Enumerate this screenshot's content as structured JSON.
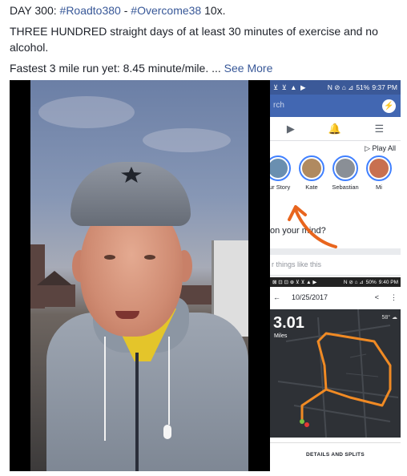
{
  "post": {
    "line1_prefix": "DAY 300: ",
    "hashtag1": "#Roadto380",
    "separator": " - ",
    "hashtag2": "#Overcome38",
    "line1_suffix": " 10x.",
    "line2": "THREE HUNDRED straight days of at least 30 minutes of exercise and no alcohol.",
    "line3": "Fastest 3 mile run yet: 8.45 minute/mile. ...",
    "see_more": "See More"
  },
  "phone1": {
    "status_icons": "⊻ ⊻ ▲ ▶",
    "status_right_icons": "N ⊘ ⌂ ⊿",
    "battery": "51%",
    "time": "9:37 PM",
    "search_placeholder": "rch",
    "play_all": "Play All",
    "stories": [
      {
        "label": "our Story",
        "color": "#6a8fb0"
      },
      {
        "label": "Kate",
        "color": "#b08a60"
      },
      {
        "label": "Sebastian",
        "color": "#8a8f96"
      },
      {
        "label": "Mi",
        "color": "#c87050"
      }
    ],
    "mind_prompt": "on your mind?",
    "things_placeholder": "r things like this",
    "arrow_color": "#e8651e"
  },
  "phone2": {
    "status_icons": "⊠ ⊡ ⊡ ⊕ ⊻ ⊻ ▲ ▶",
    "status_right_icons": "N ⊘ ⌂ ⊿",
    "battery": "50%",
    "time": "9:40 PM",
    "back": "←",
    "date": "10/25/2017",
    "distance": "3.01",
    "distance_unit": "Miles",
    "weather": "58°",
    "details_button": "DETAILS AND SPLITS",
    "route_color": "#f08a24"
  }
}
